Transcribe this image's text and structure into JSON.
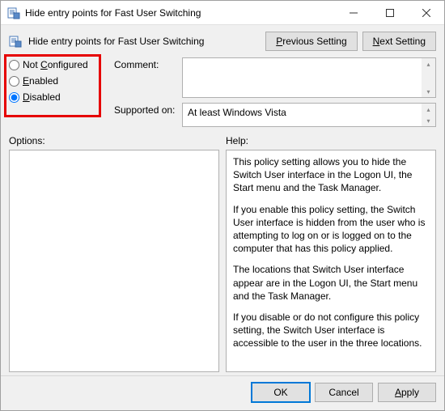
{
  "window": {
    "title": "Hide entry points for Fast User Switching"
  },
  "header": {
    "title": "Hide entry points for Fast User Switching",
    "previous": "Previous Setting",
    "next": "Next Setting"
  },
  "radios": {
    "notConfigured": "Not Configured",
    "enabled": "Enabled",
    "disabled": "Disabled",
    "selected": "disabled"
  },
  "fields": {
    "commentLabel": "Comment:",
    "commentValue": "",
    "supportedLabel": "Supported on:",
    "supportedValue": "At least Windows Vista"
  },
  "panels": {
    "optionsLabel": "Options:",
    "helpLabel": "Help:",
    "helpParagraphs": [
      "This policy setting allows you to hide the Switch User interface in the Logon UI, the Start menu and the Task Manager.",
      "If you enable this policy setting, the Switch User interface is hidden from the user who is attempting to log on or is logged on to the computer that has this policy applied.",
      "The locations that Switch User interface appear are in the Logon UI, the Start menu and the Task Manager.",
      "If you disable or do not configure this policy setting, the Switch User interface is accessible to the user in the three locations."
    ]
  },
  "buttons": {
    "ok": "OK",
    "cancel": "Cancel",
    "apply": "Apply"
  }
}
